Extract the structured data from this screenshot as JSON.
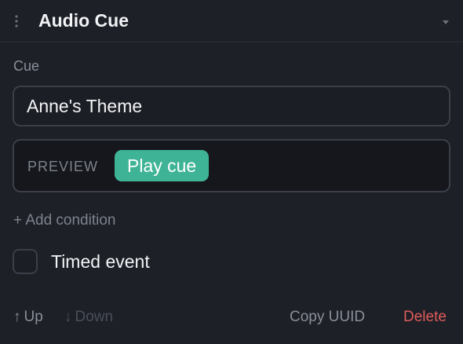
{
  "header": {
    "title": "Audio Cue",
    "drag_icon": "drag-handle-icon",
    "collapse_icon": "caret-down-icon"
  },
  "cue": {
    "label": "Cue",
    "value": "Anne's Theme"
  },
  "preview": {
    "label": "PREVIEW",
    "play_label": "Play cue"
  },
  "add_condition": {
    "label": "+ Add condition"
  },
  "timed_event": {
    "label": "Timed event",
    "checked": false
  },
  "footer": {
    "up_arrow": "↑",
    "up_label": "Up",
    "down_arrow": "↓",
    "down_label": "Down",
    "copy_label": "Copy UUID",
    "delete_label": "Delete"
  },
  "colors": {
    "background": "#1d2027",
    "accent": "#3fb396",
    "danger": "#e05b5b",
    "muted_text": "#8a8f99",
    "disabled_text": "#4a4f59"
  }
}
